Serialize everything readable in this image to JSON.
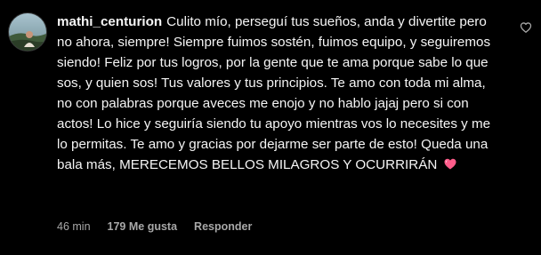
{
  "comment": {
    "username": "mathi_centurion",
    "text": "Culito mío, perseguí tus sueños, anda y divertite pero no ahora, siempre! Siempre fuimos sostén, fuimos equipo, y seguiremos siendo! Feliz por tus logros, por la gente que te ama porque sabe lo que sos, y quien sos! Tus valores y tus principios. Te amo con toda mi alma, no con palabras porque aveces me enojo y no hablo jajaj pero si con actos! Lo hice y seguiría siendo tu apoyo mientras vos lo necesites y me lo permitas. Te amo y gracias por dejarme ser parte de esto! Queda una bala más, MERECEMOS BELLOS MILAGROS Y OCURRIRÁN",
    "emoji": "pink-heart-emoji",
    "time": "46 min",
    "likes": "179 Me gusta",
    "reply_label": "Responder",
    "like_icon": "heart-outline-icon"
  },
  "colors": {
    "background": "#000000",
    "text": "#f5f5f5",
    "meta_text": "#a8a8a8",
    "heart_emoji": "#ff5c8a"
  }
}
